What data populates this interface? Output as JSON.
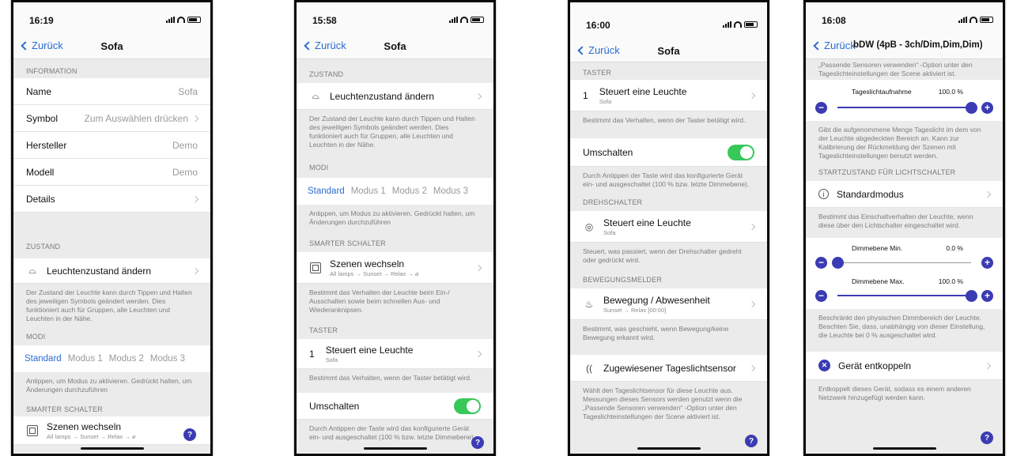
{
  "common": {
    "back_label": "Zurück",
    "help_label": "?"
  },
  "screen1": {
    "time": "16:19",
    "title": "Sofa",
    "information_header": "INFORMATION",
    "info_rows": [
      {
        "label": "Name",
        "value": "Sofa"
      },
      {
        "label": "Symbol",
        "value": "Zum Auswählen drücken"
      },
      {
        "label": "Hersteller",
        "value": "Demo"
      },
      {
        "label": "Modell",
        "value": "Demo"
      },
      {
        "label": "Details",
        "value": ""
      }
    ],
    "zustand_header": "ZUSTAND",
    "zustand_label": "Leuchtenzustand ändern",
    "zustand_desc": "Der Zustand der Leuchte kann durch Tippen und Halten des jeweiligen Symbols geändert werden. Dies funktioniert auch für Gruppen, alle Leuchten und Leuchten in der Nähe.",
    "modi_header": "MODI",
    "modes": [
      "Standard",
      "Modus 1",
      "Modus 2",
      "Modus 3"
    ],
    "modi_desc": "Antippen, um Modus zu aktivieren. Gedrückt halten, um Änderungen durchzuführen",
    "smart_header": "SMARTER SCHALTER",
    "scene_label": "Szenen wechseln",
    "scene_sub": "All lamps → Sunset → Relax → ⌀"
  },
  "screen2": {
    "time": "15:58",
    "title": "Sofa",
    "zustand_header": "ZUSTAND",
    "zustand_label": "Leuchtenzustand ändern",
    "zustand_desc": "Der Zustand der Leuchte kann durch Tippen und Halten des jeweiligen Symbols geändert werden. Dies funktioniert auch für Gruppen, alle Leuchten und Leuchten in der Nähe.",
    "modi_header": "MODI",
    "modes": [
      "Standard",
      "Modus 1",
      "Modus 2",
      "Modus 3"
    ],
    "modi_desc": "Antippen, um Modus zu aktivieren. Gedrückt halten, um Änderungen durchzuführen",
    "smart_header": "SMARTER SCHALTER",
    "scene_label": "Szenen wechseln",
    "scene_sub": "All lamps → Sunset → Relax → ⌀",
    "scene_desc": "Bestimmt das Verhalten der Leuchte beim Ein-/ Ausschalten sowie beim schnellen Aus- und Wiederanknipsen.",
    "taster_header": "TASTER",
    "taster_num": "1",
    "taster_label": "Steuert eine Leuchte",
    "taster_sub": "Sofa",
    "taster_desc": "Bestimmt das Verhalten, wenn der Taster betätigt wird.",
    "toggle_label": "Umschalten",
    "toggle_desc": "Durch Antippen der Taste wird das konfigurierte Gerät ein- und ausgeschaltet (100 % bzw. letzte Dimmebene)."
  },
  "screen3": {
    "time": "16:00",
    "title": "Sofa",
    "taster_header": "TASTER",
    "taster_num": "1",
    "taster_label": "Steuert eine Leuchte",
    "taster_sub": "Sofa",
    "taster_desc": "Bestimmt das Verhalten, wenn der Taster betätigt wird.",
    "toggle_label": "Umschalten",
    "toggle_desc": "Durch Antippen der Taste wird das konfigurierte Gerät ein- und ausgeschaltet (100 % bzw. letzte Dimmebene).",
    "dreh_header": "DREHSCHALTER",
    "dreh_label": "Steuert eine Leuchte",
    "dreh_sub": "Sofa",
    "dreh_desc": "Steuert, was passiert, wenn der Drehschalter gedreht oder gedrückt wird.",
    "motion_header": "BEWEGUNGSMELDER",
    "motion_label": "Bewegung / Abwesenheit",
    "motion_sub": "Sunset → Relax [00:00]",
    "motion_desc": "Bestimmt, was geschieht, wenn Bewegung/keine Bewegung erkannt wird.",
    "daylight_label": "Zugewiesener Tageslichtsensor",
    "daylight_desc": "Wählt den Tageslichtsensor für diese Leuchte aus. Messungen dieses Sensors werden genutzt wenn die „Passende Sensoren verwenden“ -Option unter den Tageslichteinstellungen der Scene aktiviert ist."
  },
  "screen4": {
    "time": "16:08",
    "title": "bDW (4pB - 3ch/Dim,Dim,Dim)",
    "top_desc": "„Passende Sensoren verwenden“ -Option unter den Tageslichteinstellungen der Scene aktiviert ist.",
    "tl_label": "Tageslichtaufnahme",
    "tl_value": "100.0 %",
    "tl_level": 1.0,
    "tl_desc": "Gibt die aufgenommene Menge Tageslicht im dem von der Leuchte abgedeckten Bereich an. Kann zur Kalibrierung der Rückmeldung der Szenen mit Tageslichteinstellungen benutzt werden.",
    "start_header": "STARTZUSTAND FÜR LICHTSCHALTER",
    "start_label": "Standardmodus",
    "start_desc": "Bestimmt das Einschaltverhalten der Leuchte, wenn diese über den Lichtschalter eingeschaltet wird.",
    "dim_min_label": "Dimmebene Min.",
    "dim_min_value": "0.0 %",
    "dim_min_level": 0.0,
    "dim_max_label": "Dimmebene Max.",
    "dim_max_value": "100.0 %",
    "dim_max_level": 1.0,
    "dim_desc": "Beschränkt den physischen Dimmbereich der Leuchte. Beachten Sie, dass, unabhängig von dieser Einstellung, die Leuchte bei 0 % ausgeschaltet wird.",
    "decouple_label": "Gerät entkoppeln",
    "decouple_desc": "Entkoppelt dieses Gerät, sodass es einem anderen Netzwerk hinzugefügt werden kann."
  }
}
